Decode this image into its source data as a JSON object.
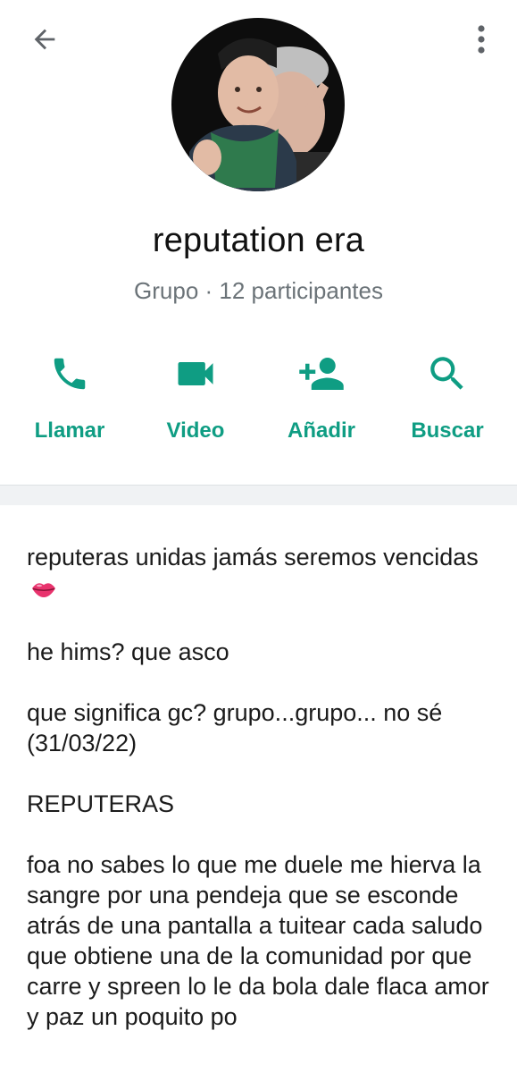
{
  "header": {
    "back_icon": "arrow-left-icon",
    "menu_icon": "more-vertical-icon"
  },
  "group": {
    "name": "reputation era",
    "meta": "Grupo · 12 participantes"
  },
  "actions": [
    {
      "label": "Llamar",
      "icon": "phone-icon"
    },
    {
      "label": "Video",
      "icon": "video-camera-icon"
    },
    {
      "label": "Añadir",
      "icon": "add-person-icon"
    },
    {
      "label": "Buscar",
      "icon": "search-icon"
    }
  ],
  "description": {
    "p1": "reputeras unidas jamás seremos vencidas",
    "p1_emoji": "lips-kiss-emoji",
    "p2": "he hims? que asco",
    "p3": "que significa gc? grupo...grupo...  no sé (31/03/22)",
    "p4": "REPUTERAS",
    "p5": "foa no sabes lo que me duele me hierva la sangre por una pendeja que se esconde atrás de una pantalla a tuitear cada saludo que obtiene una de la comunidad por que carre y spreen lo le da bola dale flaca amor y paz un poquito po"
  },
  "colors": {
    "accent": "#0f9d83",
    "subtitle": "#6b7378",
    "divider": "#f0f2f4"
  }
}
